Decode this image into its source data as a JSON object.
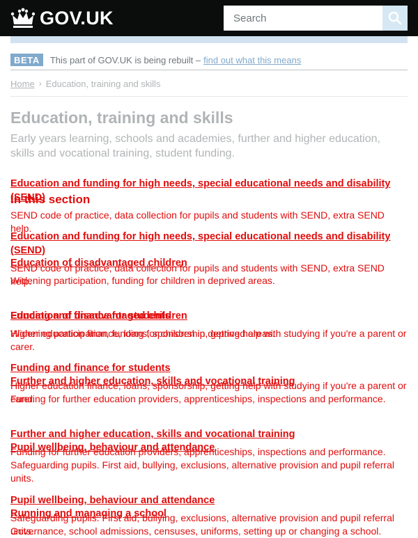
{
  "header": {
    "logo_text": "GOV.UK",
    "search": {
      "placeholder": "Search"
    },
    "search_icon": "search-icon",
    "colors": {
      "bar": "#0b0c0c",
      "stripe": "#d2e2f1",
      "search_button": "#d5e8f3"
    }
  },
  "beta_banner": {
    "tag": "BETA",
    "text": "This part of GOV.UK is being rebuilt –",
    "link": "find out what this means"
  },
  "breadcrumb": {
    "home": "Home",
    "current": "Education, training and skills"
  },
  "page": {
    "title": "Education, training and skills",
    "summary": "Early years learning, schools and academies, further and higher education, skills and vocational training, student funding."
  },
  "in_section_heading": "In this section",
  "items": [
    {
      "title": "Education and funding for high needs, special educational needs and disability (SEND)",
      "desc": "SEND code of practice, data collection for pupils and students with SEND, extra SEND help."
    },
    {
      "title": "Education and funding for high needs, special educational needs and disability (SEND)",
      "desc": "SEND code of practice, data collection for pupils and students with SEND, extra SEND help."
    },
    {
      "title": "Education of disadvantaged children",
      "desc": "Widening participation, funding for children in deprived areas."
    },
    {
      "title": "Education of disadvantaged children",
      "desc": "Widening participation, funding for children in deprived areas."
    },
    {
      "title": "Funding and finance for students",
      "desc": "Higher education finance, loans, sponsorship, getting help with studying if you're a parent or carer."
    },
    {
      "title": "Funding and finance for students",
      "desc": "Higher education finance, loans, sponsorship, getting help with studying if you're a parent or carer."
    },
    {
      "title": "Further and higher education, skills and vocational training",
      "desc": "Funding for further education providers, apprenticeships, inspections and performance."
    },
    {
      "title": "Further and higher education, skills and vocational training",
      "desc": "Funding for further education providers, apprenticeships, inspections and performance."
    },
    {
      "title": "Pupil wellbeing, behaviour and attendance",
      "desc": "Safeguarding pupils. First aid, bullying, exclusions, alternative provision and pupil referral units."
    },
    {
      "title": "Pupil wellbeing, behaviour and attendance",
      "desc": "Safeguarding pupils. First aid, bullying, exclusions, alternative provision and pupil referral units."
    },
    {
      "title": "Running and managing a school",
      "desc": "Governance, school admissions, censuses, uniforms, setting up or changing a school."
    }
  ]
}
